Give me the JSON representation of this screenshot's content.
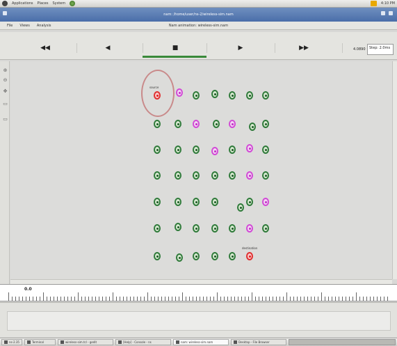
{
  "top_panel": {
    "menus": [
      "Applications",
      "Places",
      "System"
    ],
    "icons": [
      "gnome-foot-icon",
      "web-browser-icon",
      "network-icon"
    ],
    "clock": "4:10 PM"
  },
  "window": {
    "title": "nam: /home/user/ns-2/wireless-sim.nam",
    "menus": [
      "File",
      "Views",
      "Analysis"
    ],
    "sim_time_text": "Nam animation: wireless-sim.nam"
  },
  "toolbar": {
    "rewind": "◀◀",
    "back": "◀",
    "stop": "■",
    "play": "▶",
    "fast_forward": "▶▶",
    "time": "4.0890",
    "step_label": "Step: 2.0ms"
  },
  "side_tools": [
    "zoom-in-icon",
    "zoom-out-icon",
    "pan-icon",
    "edit-icon",
    "select-icon"
  ],
  "nodes": [
    {
      "id": "0",
      "color": "red",
      "label": "source"
    },
    {
      "id": "1",
      "color": "pink"
    },
    {
      "id": "2",
      "color": "green"
    },
    {
      "id": "3",
      "color": "green"
    },
    {
      "id": "4",
      "color": "green"
    },
    {
      "id": "5",
      "color": "green"
    },
    {
      "id": "6",
      "color": "green"
    },
    {
      "id": "7",
      "color": "green"
    },
    {
      "id": "8",
      "color": "green"
    },
    {
      "id": "9",
      "color": "pink"
    },
    {
      "id": "10",
      "color": "green"
    },
    {
      "id": "11",
      "color": "pink"
    },
    {
      "id": "12",
      "color": "green"
    },
    {
      "id": "13",
      "color": "green"
    },
    {
      "id": "14",
      "color": "green"
    },
    {
      "id": "15",
      "color": "green"
    },
    {
      "id": "16",
      "color": "green"
    },
    {
      "id": "17",
      "color": "pink"
    },
    {
      "id": "18",
      "color": "green"
    },
    {
      "id": "19",
      "color": "pink"
    },
    {
      "id": "20",
      "color": "green"
    },
    {
      "id": "21",
      "color": "green"
    },
    {
      "id": "22",
      "color": "green"
    },
    {
      "id": "23",
      "color": "green"
    },
    {
      "id": "24",
      "color": "green"
    },
    {
      "id": "25",
      "color": "green"
    },
    {
      "id": "26",
      "color": "pink"
    },
    {
      "id": "27",
      "color": "green"
    },
    {
      "id": "28",
      "color": "green"
    },
    {
      "id": "29",
      "color": "green"
    },
    {
      "id": "30",
      "color": "green"
    },
    {
      "id": "31",
      "color": "green"
    },
    {
      "id": "32",
      "color": "green"
    },
    {
      "id": "33",
      "color": "green"
    },
    {
      "id": "34",
      "color": "pink"
    },
    {
      "id": "35",
      "color": "green"
    },
    {
      "id": "36",
      "color": "green"
    },
    {
      "id": "37",
      "color": "green"
    },
    {
      "id": "38",
      "color": "green"
    },
    {
      "id": "39",
      "color": "green"
    },
    {
      "id": "40",
      "color": "pink"
    },
    {
      "id": "41",
      "color": "green"
    },
    {
      "id": "42",
      "color": "green"
    },
    {
      "id": "43",
      "color": "green"
    },
    {
      "id": "44",
      "color": "green"
    },
    {
      "id": "45",
      "color": "green"
    },
    {
      "id": "46",
      "color": "green"
    },
    {
      "id": "47",
      "color": "red",
      "label": "destination"
    }
  ],
  "timeline": {
    "label": "0.0"
  },
  "taskbar": {
    "items": [
      "ns-2.35",
      "Terminal",
      "wireless-sim.tcl - gedit",
      "[Help] - Console - ns",
      "nam: wireless-sim.nam",
      "Desktop - File Browser"
    ]
  }
}
